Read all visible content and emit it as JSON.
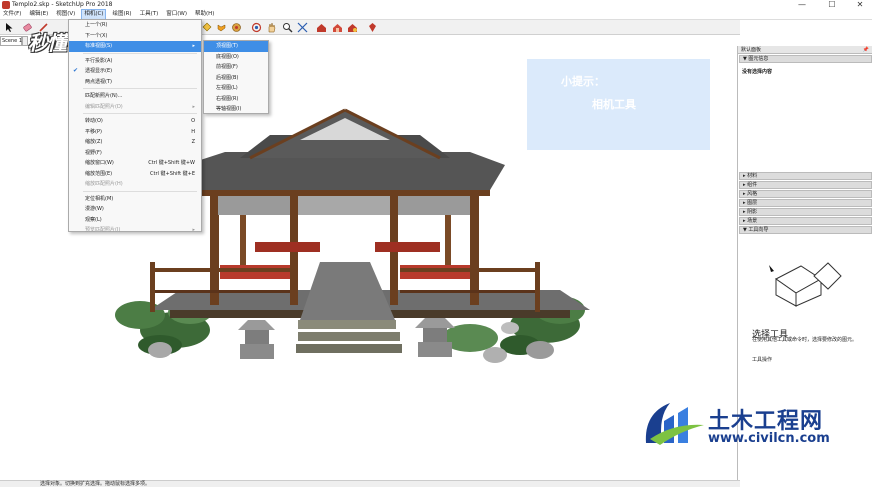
{
  "window": {
    "title": "Templo2.skp - SketchUp Pro 2018",
    "minimize": "—",
    "maximize": "☐",
    "close": "✕"
  },
  "menubar": [
    "文件(F)",
    "编辑(E)",
    "视图(V)",
    "相机(C)",
    "绘图(R)",
    "工具(T)",
    "窗口(W)",
    "帮助(H)"
  ],
  "scene_tab": "Scene 1",
  "watermark": "秒懂视频",
  "camera_menu": {
    "items": [
      {
        "label": "上一个(R)",
        "shortcut": "",
        "state": ""
      },
      {
        "label": "下一个(X)",
        "shortcut": "",
        "state": ""
      },
      {
        "label": "标准视图(S)",
        "shortcut": "▸",
        "state": "hl"
      },
      {
        "sep": true
      },
      {
        "label": "平行投影(A)",
        "shortcut": "",
        "state": ""
      },
      {
        "label": "透视显示(E)",
        "shortcut": "",
        "state": "check"
      },
      {
        "label": "两点透视(T)",
        "shortcut": "",
        "state": ""
      },
      {
        "sep": true
      },
      {
        "label": "匹配新照片(N)...",
        "shortcut": "",
        "state": ""
      },
      {
        "label": "编辑匹配照片(D)",
        "shortcut": "▸",
        "state": "dis"
      },
      {
        "sep": true
      },
      {
        "label": "转动(O)",
        "shortcut": "O",
        "state": ""
      },
      {
        "label": "平移(P)",
        "shortcut": "H",
        "state": ""
      },
      {
        "label": "缩放(Z)",
        "shortcut": "Z",
        "state": ""
      },
      {
        "label": "视野(F)",
        "shortcut": "",
        "state": ""
      },
      {
        "label": "缩放窗口(W)",
        "shortcut": "Ctrl 键+Shift 键+W",
        "state": ""
      },
      {
        "label": "缩放范围(E)",
        "shortcut": "Ctrl 键+Shift 键+E",
        "state": ""
      },
      {
        "label": "缩放匹配照片(H)",
        "shortcut": "",
        "state": "dis"
      },
      {
        "sep": true
      },
      {
        "label": "定位相机(M)",
        "shortcut": "",
        "state": ""
      },
      {
        "label": "漫游(W)",
        "shortcut": "",
        "state": ""
      },
      {
        "label": "观察(L)",
        "shortcut": "",
        "state": ""
      },
      {
        "label": "预览匹配照片(I)",
        "shortcut": "▸",
        "state": "dis"
      }
    ]
  },
  "standard_views": [
    "顶视图(T)",
    "底视图(O)",
    "前视图(F)",
    "后视图(B)",
    "左视图(L)",
    "右视图(R)",
    "等轴视图(I)"
  ],
  "tip": {
    "title": "小提示：",
    "body": "相机工具"
  },
  "tray": {
    "header": "默认面板",
    "scenes_header": "▼ 图元信息",
    "scenes_body": "没有选择内容",
    "panels": [
      "▸ 材料",
      "▸ 组件",
      "▸ 风格",
      "▸ 图层",
      "▸ 阴影",
      "▸ 场景",
      "▼ 工具向导"
    ],
    "tool_title": "选择工具",
    "tool_desc": "在使用其他工具或命令时，选择要修改的图元。",
    "tool_more": "工具操作"
  },
  "status": "选择对象。切换到扩充选择。拖动鼠标选择多项。",
  "logo": {
    "name": "土木工程网",
    "url": "www.civilcn.com"
  }
}
